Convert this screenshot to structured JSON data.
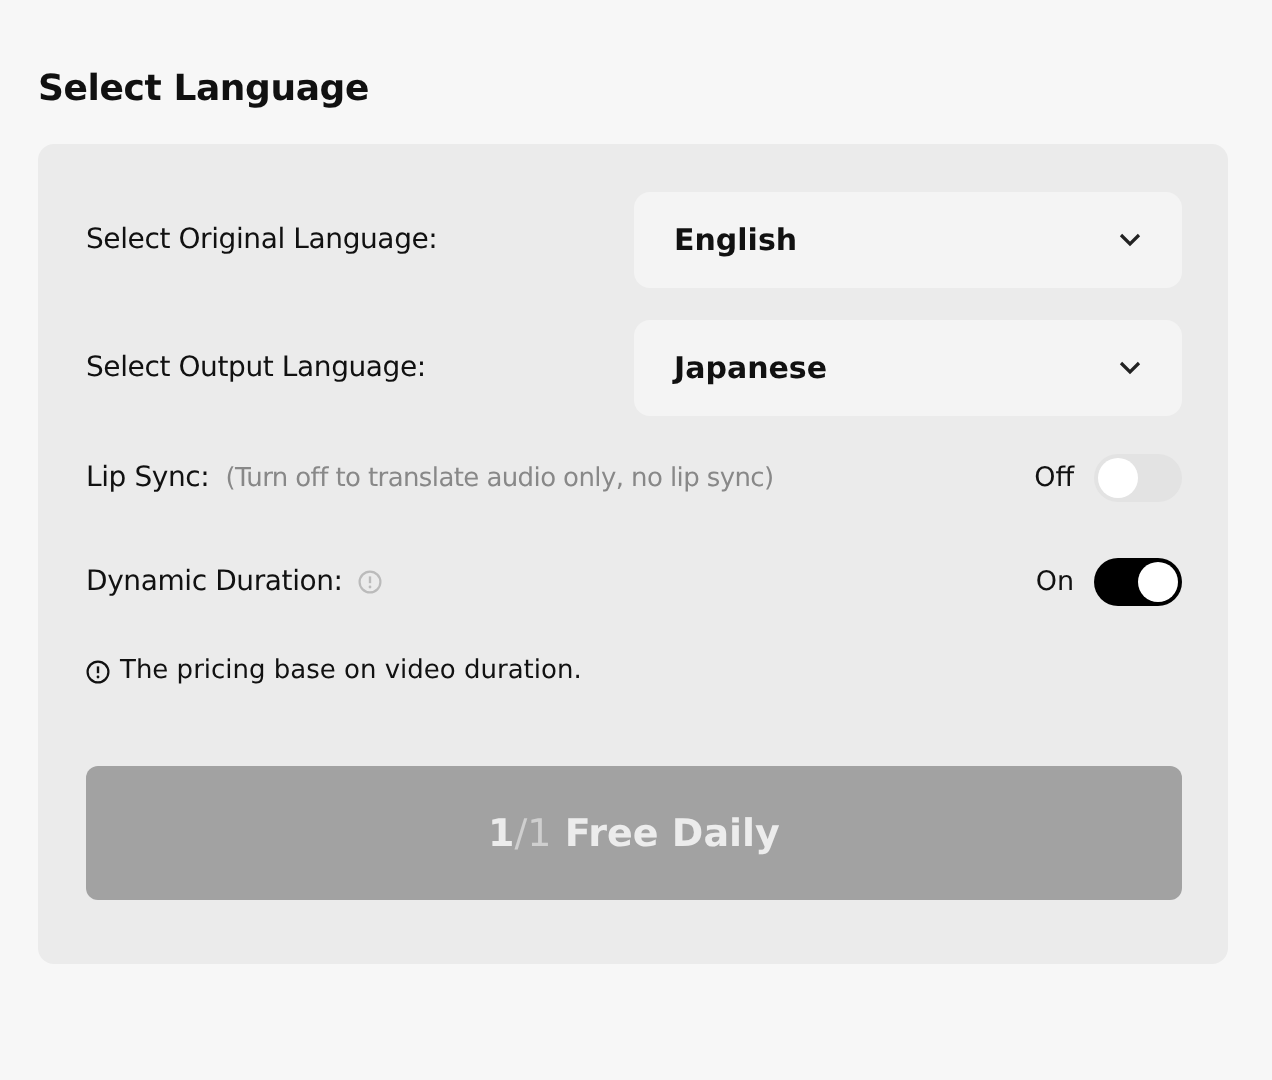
{
  "heading": "Select Language",
  "selects": [
    {
      "label": "Select Original Language:",
      "value": "English"
    },
    {
      "label": "Select Output Language:",
      "value": "Japanese"
    }
  ],
  "toggles": [
    {
      "label": "Lip Sync:",
      "hint": "(Turn off to translate audio only, no lip sync)",
      "info_icon": false,
      "state_text": "Off",
      "on": false
    },
    {
      "label": "Dynamic Duration:",
      "info_icon": true,
      "state_text": "On",
      "on": true
    }
  ],
  "note": "The pricing base on video duration.",
  "button": {
    "used": "1",
    "total": "/1",
    "label": "Free Daily",
    "disabled": true
  }
}
